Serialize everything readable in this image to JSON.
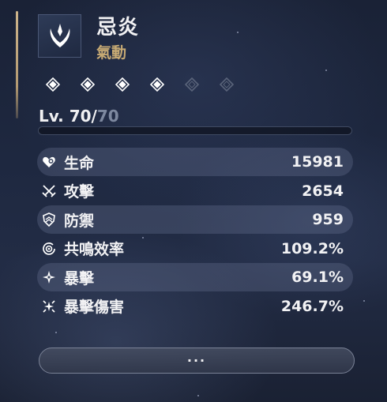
{
  "character": {
    "name": "忌炎",
    "element": "氣動",
    "level_current": "Lv. 70/",
    "level_max": "70",
    "sequence_nodes": [
      true,
      true,
      true,
      true,
      false,
      false
    ]
  },
  "stats": [
    {
      "label": "生命",
      "value": "15981",
      "icon": "heart-icon"
    },
    {
      "label": "攻擊",
      "value": "2654",
      "icon": "crossed-swords-icon"
    },
    {
      "label": "防禦",
      "value": "959",
      "icon": "shield-icon"
    },
    {
      "label": "共鳴效率",
      "value": "109.2%",
      "icon": "resonance-icon"
    },
    {
      "label": "暴擊",
      "value": "69.1%",
      "icon": "crit-star-icon"
    },
    {
      "label": "暴擊傷害",
      "value": "246.7%",
      "icon": "crit-burst-icon"
    }
  ],
  "more_button_label": "···",
  "colors": {
    "accent_gold": "#c7aa74",
    "text": "#f2f2f4",
    "max_level": "#7d889f"
  }
}
